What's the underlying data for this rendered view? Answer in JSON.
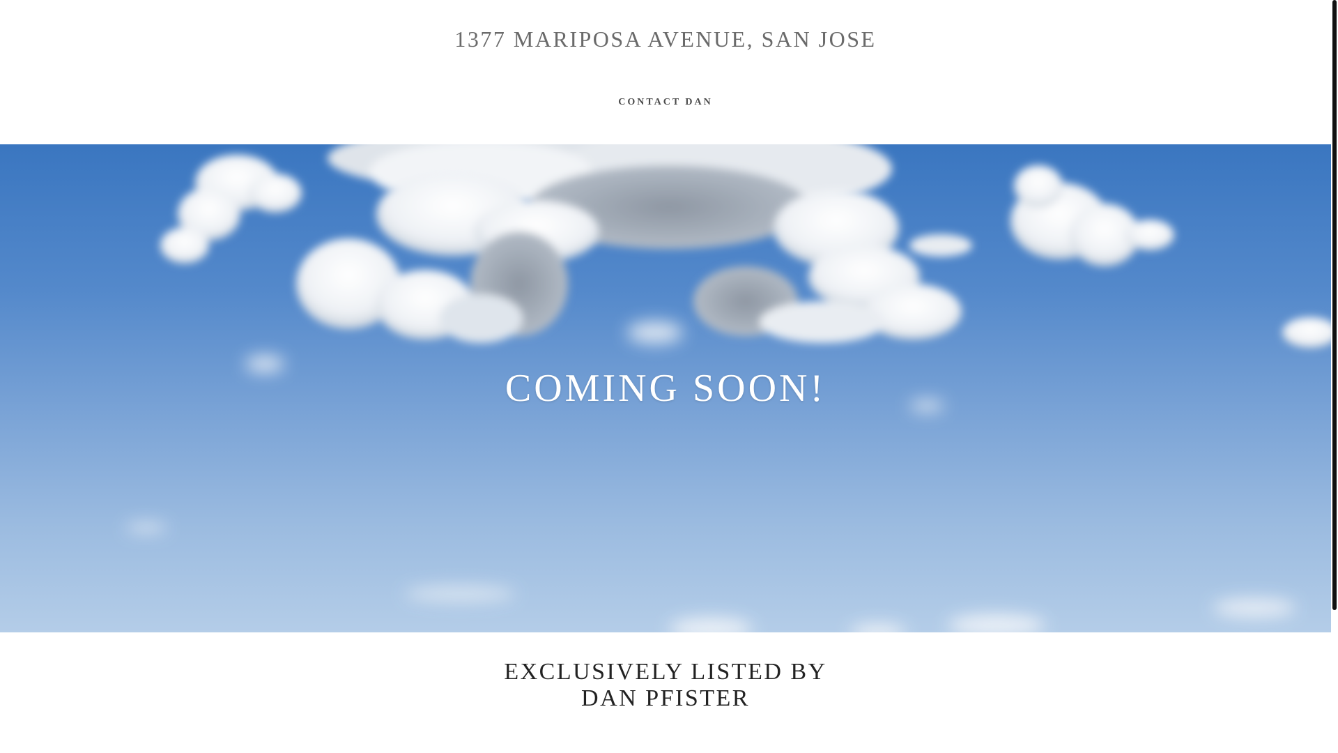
{
  "header": {
    "site_title": "1377 MARIPOSA AVENUE, SAN JOSE",
    "nav": {
      "contact_label": "CONTACT DAN"
    }
  },
  "hero": {
    "image": "sky-with-clouds",
    "heading": "COMING SOON!",
    "colors": {
      "sky_top": "#3a76c0",
      "sky_bottom": "#b4cde8",
      "heading_text": "#ffffff"
    }
  },
  "listing": {
    "line1": "EXCLUSIVELY LISTED BY",
    "line2": "DAN PFISTER"
  },
  "colors": {
    "title_text": "#6a6a6a",
    "nav_text": "#4a4a4a",
    "body_text": "#222222",
    "background": "#ffffff"
  }
}
